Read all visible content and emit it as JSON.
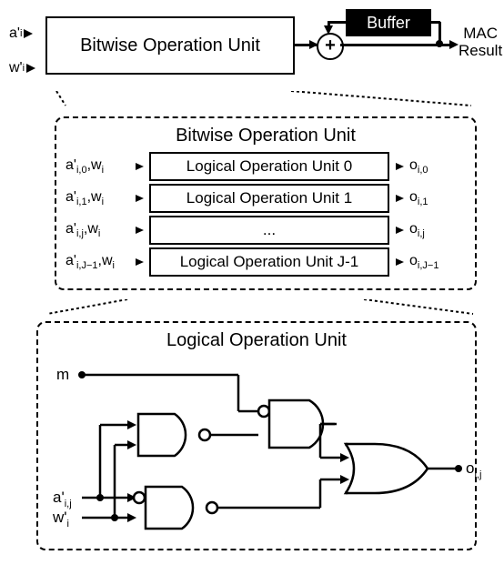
{
  "top": {
    "input_a": "a'",
    "input_a_sub": "i",
    "input_w": "w'",
    "input_w_sub": "i",
    "unit_label": "Bitwise Operation Unit",
    "buffer_label": "Buffer",
    "adder_symbol": "+",
    "output_line1": "MAC",
    "output_line2": "Result"
  },
  "mid": {
    "title": "Bitwise Operation Unit",
    "rows": [
      {
        "in_a": "a'",
        "in_a_sub": "i,0",
        "in_w": "w",
        "in_w_sub": "i",
        "label": "Logical Operation Unit 0",
        "out": "o",
        "out_sub": "i,0"
      },
      {
        "in_a": "a'",
        "in_a_sub": "i,1",
        "in_w": "w",
        "in_w_sub": "i",
        "label": "Logical Operation Unit 1",
        "out": "o",
        "out_sub": "i,1"
      },
      {
        "in_a": "a'",
        "in_a_sub": "i,j",
        "in_w": "w",
        "in_w_sub": "i",
        "label": "...",
        "out": "o",
        "out_sub": "i,j"
      },
      {
        "in_a": "a'",
        "in_a_sub": "i,J−1",
        "in_w": "w",
        "in_w_sub": "i",
        "label": "Logical Operation Unit J-1",
        "out": "o",
        "out_sub": "i,J−1"
      }
    ]
  },
  "logic": {
    "title": "Logical Operation Unit",
    "input_m": "m",
    "input_a": "a'",
    "input_a_sub": "i,j",
    "input_w": "w'",
    "input_w_sub": "i",
    "output": "o",
    "output_sub": "i,j"
  },
  "chart_data": {
    "type": "diagram",
    "description": "Hierarchical hardware block diagram of a Bitwise Operation Unit used inside a MAC (multiply-accumulate) datapath.",
    "top_level": {
      "block": "Bitwise Operation Unit",
      "inputs": [
        "a'_i",
        "w'_i"
      ],
      "combine": "adder (+) with feedback Buffer",
      "output": "MAC Result"
    },
    "middle_level": {
      "block": "Bitwise Operation Unit (expanded)",
      "subunits": "J parallel Logical Operation Units, index j = 0 .. J-1",
      "per_unit_inputs": [
        "a'_{i,j}",
        "w_i"
      ],
      "per_unit_output": "o_{i,j}"
    },
    "leaf_level": {
      "block": "Logical Operation Unit",
      "inputs": [
        "m",
        "a'_{i,j}",
        "w'_i"
      ],
      "gates": [
        {
          "id": "G1",
          "type": "NAND",
          "inputs": [
            "a'_{i,j}",
            "w'_i"
          ]
        },
        {
          "id": "G2",
          "type": "AND",
          "bubble_on_input": 0,
          "inputs": [
            "m",
            "G1"
          ],
          "note": "input 0 inverted (bubble)"
        },
        {
          "id": "G3",
          "type": "NAND",
          "bubble_on_input": 0,
          "inputs": [
            "a'_{i,j}",
            "w'_i"
          ],
          "note": "input 0 inverted (bubble)"
        },
        {
          "id": "G4",
          "type": "OR",
          "inputs": [
            "G2",
            "G3"
          ]
        }
      ],
      "output": "o_{i,j} = G4"
    }
  }
}
